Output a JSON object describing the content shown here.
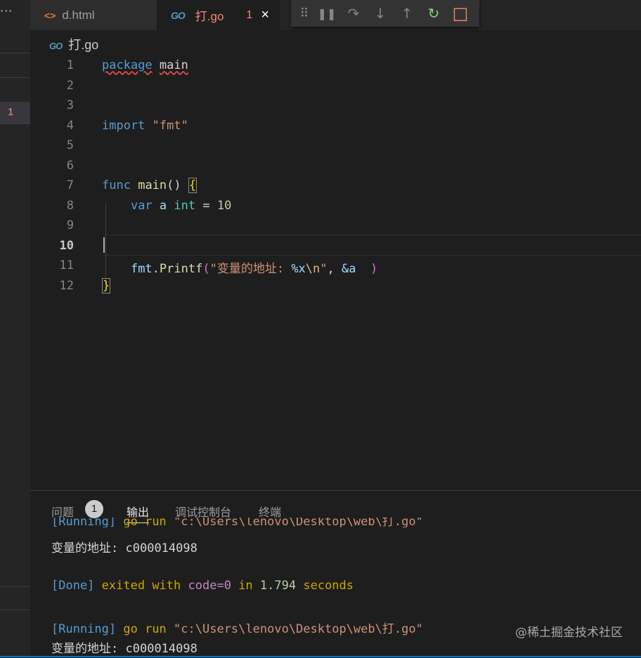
{
  "tabs": [
    {
      "icon": "html-icon",
      "glyph": "<>",
      "label": "d.html"
    },
    {
      "icon": "go-icon",
      "glyph": "GO",
      "label": "打.go",
      "problems": "1",
      "close": "×"
    }
  ],
  "debug_toolbar": {
    "grip": "⠿",
    "pause": "❚❚",
    "step_over": "↷",
    "step_into": "↓",
    "step_out": "↑",
    "restart": "↻",
    "stop": "□"
  },
  "sidebar": {
    "more": "···",
    "problem_count": "1"
  },
  "breadcrumb": {
    "icon": "GO",
    "file": "打.go"
  },
  "editor": {
    "line_numbers": [
      "1",
      "2",
      "3",
      "4",
      "5",
      "6",
      "7",
      "8",
      "9",
      "10",
      "11",
      "12"
    ],
    "current_line": "10",
    "code": {
      "l1_kw": "package",
      "l1_name": "main",
      "l4_kw": "import",
      "l4_str": "\"fmt\"",
      "l7_kw": "func",
      "l7_fn": "main",
      "l7_paren": "()",
      "l7_brace": "{",
      "l8_kw": "var",
      "l8_var": "a",
      "l8_type": "int",
      "l8_op": "=",
      "l8_num": "10",
      "l11_pkg": "fmt",
      "l11_dot": ".",
      "l11_fn": "Printf",
      "l11_open": "(",
      "l11_str1": "\"变量的地址: ",
      "l11_fmtv": "%x",
      "l11_esc": "\\n",
      "l11_str2": "\"",
      "l11_comma": ", ",
      "l11_arg": "&a",
      "l11_close": ")",
      "l12_brace": "}"
    }
  },
  "panel": {
    "tabs": {
      "problems": "问题",
      "problems_count": "1",
      "output": "输出",
      "debug_console": "调试控制台",
      "terminal": "终端"
    },
    "output": {
      "run_tag": "[Running]",
      "run_cmd": "go run",
      "run_path": "\"c:\\Users\\lenovo\\Desktop\\web\\打.go\"",
      "addr_label": "变量的地址:",
      "addr_value": "c000014098",
      "done_tag": "[Done]",
      "done_text": "exited with",
      "done_code": "code=0",
      "done_in": "in",
      "done_secs": "1.794",
      "done_unit": "seconds"
    }
  },
  "watermark": "@稀土掘金技术社区"
}
